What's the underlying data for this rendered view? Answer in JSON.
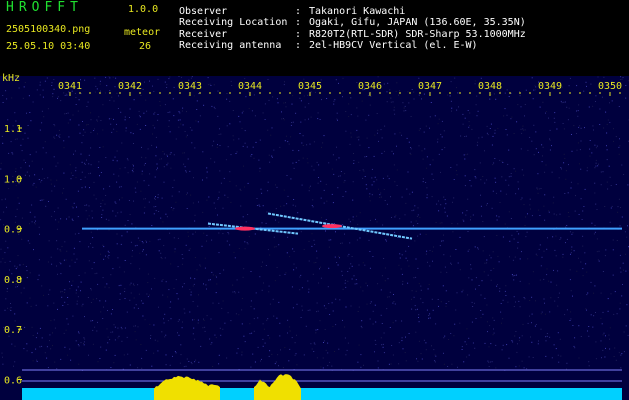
{
  "header": {
    "app_name": "HROFFT",
    "app_version": "1.0.0",
    "filename": "2505100340.png",
    "datetime": "25.05.10 03:40",
    "meteor_label": "meteor",
    "meteor_count": "26"
  },
  "meta": [
    {
      "label": "Observer",
      "value": "Takanori Kawachi"
    },
    {
      "label": "Receiving Location",
      "value": "Ogaki, Gifu, JAPAN (136.60E, 35.35N)"
    },
    {
      "label": "Receiver",
      "value": "R820T2(RTL-SDR) SDR-Sharp 53.1000MHz"
    },
    {
      "label": "Receiving antenna",
      "value": "2el-HB9CV Vertical (el. E-W)"
    }
  ],
  "colon": ":",
  "chart_data": {
    "type": "spectrogram",
    "y_unit": "kHz",
    "x_ticks": [
      "0341",
      "0342",
      "0343",
      "0344",
      "0345",
      "0346",
      "0347",
      "0348",
      "0349",
      "0350"
    ],
    "y_ticks": [
      "1.1",
      "1.0",
      "0.9",
      "0.8",
      "0.7",
      "0.6"
    ],
    "ylim": [
      0.59,
      1.18
    ],
    "carrier_khz": 0.9,
    "echoes": [
      {
        "start_min": 2.3,
        "end_min": 3.8,
        "start_khz": 0.91,
        "end_khz": 0.89
      },
      {
        "start_min": 3.3,
        "end_min": 5.7,
        "start_khz": 0.93,
        "end_khz": 0.88
      }
    ],
    "colors": {
      "background": "#00003e",
      "carrier": "#3fa0ff",
      "echo_core": "#ff3060",
      "bottom_band": "#00d0ff",
      "bottom_peak": "#f0e000",
      "label": "#e8e820"
    }
  }
}
